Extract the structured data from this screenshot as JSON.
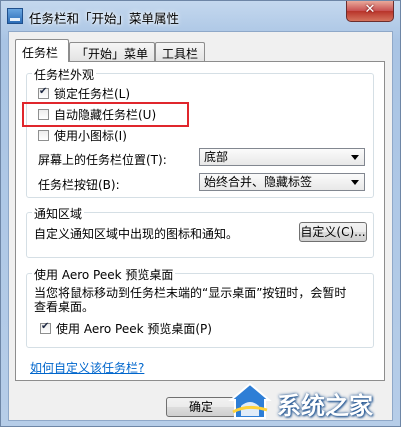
{
  "window": {
    "title": "任务栏和「开始」菜单属性",
    "close": "✕"
  },
  "tabs": [
    {
      "label": "任务栏"
    },
    {
      "label": "「开始」菜单"
    },
    {
      "label": "工具栏"
    }
  ],
  "appearance": {
    "group_label": "任务栏外观",
    "lock": {
      "label": "锁定任务栏(L)",
      "checked": true
    },
    "autohide": {
      "label": "自动隐藏任务栏(U)",
      "checked": false
    },
    "small_icons": {
      "label": "使用小图标(I)",
      "checked": false
    },
    "position_label": "屏幕上的任务栏位置(T):",
    "position_value": "底部",
    "buttons_label": "任务栏按钮(B):",
    "buttons_value": "始终合并、隐藏标签"
  },
  "notification": {
    "group_label": "通知区域",
    "text": "自定义通知区域中出现的图标和通知。",
    "customize_button": "自定义(C)..."
  },
  "aero": {
    "group_label": "使用 Aero Peek 预览桌面",
    "desc_line1": "当您将鼠标移动到任务栏末端的“显示桌面”按钮时，会暂时",
    "desc_line2": "查看桌面。",
    "checkbox": {
      "label": "使用 Aero Peek 预览桌面(P)",
      "checked": true
    }
  },
  "help_link": "如何自定义该任务栏?",
  "ok_button": "确定",
  "watermark": {
    "text": "系统之家"
  }
}
